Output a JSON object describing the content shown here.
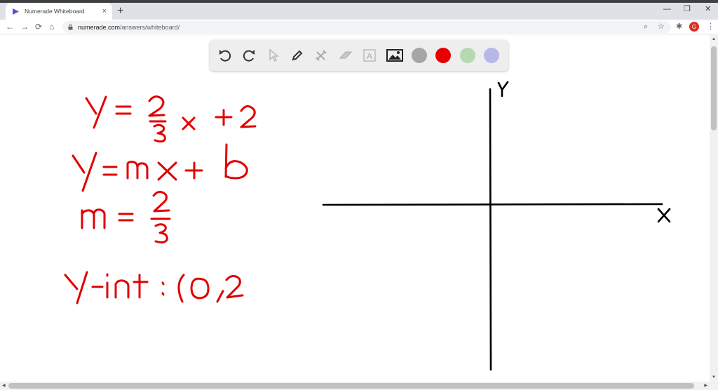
{
  "browser": {
    "tab_title": "Numerade Whiteboard",
    "tab_close": "×",
    "new_tab": "+",
    "window_controls": {
      "minimize": "—",
      "restore": "❐",
      "close": "✕"
    },
    "nav": {
      "back": "←",
      "forward": "→",
      "reload": "⟳",
      "home": "⌂"
    },
    "url_host": "numerade.com",
    "url_path": "/answers/whiteboard/",
    "zoom_icon": "⌕",
    "star_icon": "☆",
    "extensions_icon": "✱",
    "profile_initial": "G",
    "menu_icon": "⋮"
  },
  "toolbar": {
    "tools": [
      "undo-icon",
      "redo-icon",
      "pointer-icon",
      "pen-icon",
      "tools-icon",
      "eraser-icon",
      "text-icon",
      "image-icon"
    ],
    "text_tool_glyph": "A",
    "colors": [
      {
        "name": "gray",
        "hex": "#a6a6a6"
      },
      {
        "name": "red",
        "hex": "#e60000"
      },
      {
        "name": "green",
        "hex": "#b5d9b0"
      },
      {
        "name": "purple",
        "hex": "#b7b7e8"
      }
    ],
    "selected_color": "red"
  },
  "whiteboard": {
    "ink_color": "#e10000",
    "handwritten_lines": [
      "y = 2/3 x + 2",
      "y = mx + b",
      "m = 2/3",
      "y-int : (0,2"
    ],
    "axes": {
      "x_label": "x",
      "y_label": "y"
    }
  }
}
